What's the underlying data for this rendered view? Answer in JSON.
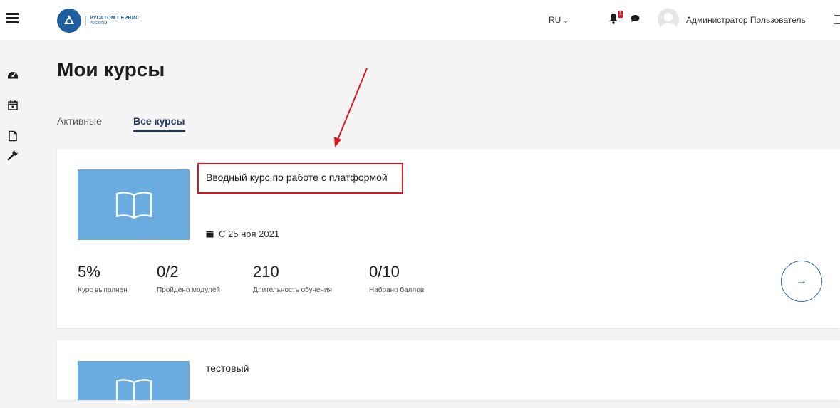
{
  "header": {
    "logo_line1": "РУСАТОМ СЕРВИС",
    "logo_line2": "РОСАТОМ",
    "language": "RU",
    "notification_count": "1",
    "user_name": "Администратор Пользователь"
  },
  "sidebar": {
    "items": [
      {
        "icon": "dashboard-icon"
      },
      {
        "icon": "calendar-icon"
      },
      {
        "icon": "file-icon"
      },
      {
        "icon": "wrench-icon"
      }
    ]
  },
  "main": {
    "title": "Мои курсы",
    "tabs": [
      {
        "label": "Активные",
        "active": false
      },
      {
        "label": "Все курсы",
        "active": true
      }
    ],
    "courses": [
      {
        "title": "Вводный курс по работе с платформой",
        "date": "С 25 ноя 2021",
        "stats": [
          {
            "value": "5%",
            "label": "Курс выполнен"
          },
          {
            "value": "0/2",
            "label": "Пройдено модулей"
          },
          {
            "value": "210",
            "label": "Длительность обучения"
          },
          {
            "value": "0/10",
            "label": "Набрано баллов"
          }
        ],
        "open_label": "→"
      },
      {
        "title": "тестовый"
      }
    ]
  },
  "colors": {
    "accent": "#1d3a63",
    "thumbnail": "#6aabe0",
    "annotation": "#e0141e",
    "badge": "#d9131f"
  }
}
